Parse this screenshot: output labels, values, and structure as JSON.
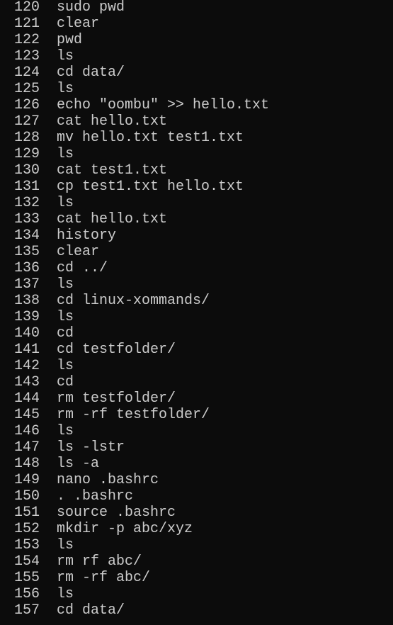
{
  "terminal": {
    "background": "#0c0c0c",
    "foreground": "#cccccc",
    "history": [
      {
        "num": "120",
        "cmd": "sudo pwd"
      },
      {
        "num": "121",
        "cmd": "clear"
      },
      {
        "num": "122",
        "cmd": "pwd"
      },
      {
        "num": "123",
        "cmd": "ls"
      },
      {
        "num": "124",
        "cmd": "cd data/"
      },
      {
        "num": "125",
        "cmd": "ls"
      },
      {
        "num": "126",
        "cmd": "echo \"oombu\" >> hello.txt"
      },
      {
        "num": "127",
        "cmd": "cat hello.txt"
      },
      {
        "num": "128",
        "cmd": "mv hello.txt test1.txt"
      },
      {
        "num": "129",
        "cmd": "ls"
      },
      {
        "num": "130",
        "cmd": "cat test1.txt"
      },
      {
        "num": "131",
        "cmd": "cp test1.txt hello.txt"
      },
      {
        "num": "132",
        "cmd": "ls"
      },
      {
        "num": "133",
        "cmd": "cat hello.txt"
      },
      {
        "num": "134",
        "cmd": "history"
      },
      {
        "num": "135",
        "cmd": "clear"
      },
      {
        "num": "136",
        "cmd": "cd ../"
      },
      {
        "num": "137",
        "cmd": "ls"
      },
      {
        "num": "138",
        "cmd": "cd linux-xommands/"
      },
      {
        "num": "139",
        "cmd": "ls"
      },
      {
        "num": "140",
        "cmd": "cd"
      },
      {
        "num": "141",
        "cmd": "cd testfolder/"
      },
      {
        "num": "142",
        "cmd": "ls"
      },
      {
        "num": "143",
        "cmd": "cd"
      },
      {
        "num": "144",
        "cmd": "rm testfolder/"
      },
      {
        "num": "145",
        "cmd": "rm -rf testfolder/"
      },
      {
        "num": "146",
        "cmd": "ls"
      },
      {
        "num": "147",
        "cmd": "ls -lstr"
      },
      {
        "num": "148",
        "cmd": "ls -a"
      },
      {
        "num": "149",
        "cmd": "nano .bashrc"
      },
      {
        "num": "150",
        "cmd": ". .bashrc"
      },
      {
        "num": "151",
        "cmd": "source .bashrc"
      },
      {
        "num": "152",
        "cmd": "mkdir -p abc/xyz"
      },
      {
        "num": "153",
        "cmd": "ls"
      },
      {
        "num": "154",
        "cmd": "rm rf abc/"
      },
      {
        "num": "155",
        "cmd": "rm -rf abc/"
      },
      {
        "num": "156",
        "cmd": "ls"
      },
      {
        "num": "157",
        "cmd": "cd data/"
      }
    ]
  }
}
